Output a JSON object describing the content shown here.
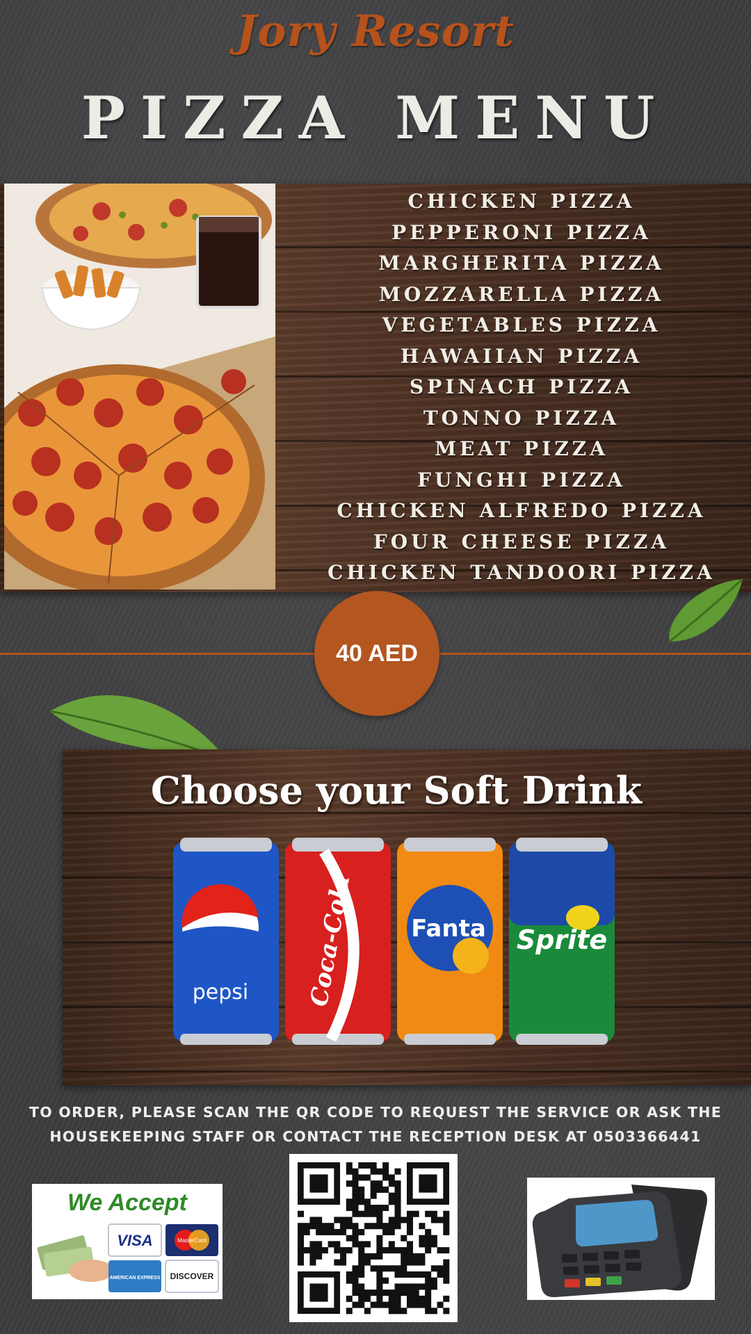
{
  "header": {
    "brand": "Jory Resort",
    "title": "PIZZA MENU"
  },
  "menu": {
    "items": [
      "CHICKEN PIZZA",
      "PEPPERONI PIZZA",
      "MARGHERITA PIZZA",
      "MOZZARELLA PIZZA",
      "VEGETABLES PIZZA",
      "HAWAIIAN PIZZA",
      "SPINACH PIZZA",
      "TONNO PIZZA",
      "MEAT PIZZA",
      "FUNGHI PIZZA",
      "CHICKEN ALFREDO PIZZA",
      "FOUR CHEESE PIZZA",
      "CHICKEN TANDOORI PIZZA"
    ],
    "price": "40 AED"
  },
  "drinks": {
    "title": "Choose your Soft Drink",
    "cans": [
      {
        "label": "pepsi",
        "color": "#1f56c6"
      },
      {
        "label": "Coca-Cola",
        "color": "#d8201f"
      },
      {
        "label": "Fanta",
        "color": "#f08a12"
      },
      {
        "label": "Sprite",
        "color": "#1a8a3a"
      }
    ]
  },
  "footer": {
    "order_note": "To order, please scan the QR code to request the service or ask the housekeeping staff or contact the reception desk at 0503366441",
    "payment": {
      "heading": "We Accept",
      "cards": [
        "VISA",
        "MasterCard",
        "AMERICAN EXPRESS",
        "DISCOVER"
      ]
    }
  },
  "colors": {
    "accent": "#b6521c",
    "background": "#3d3d3f",
    "text": "#f1eee6"
  },
  "icons": [
    "qr-code-icon",
    "card-terminal-icon",
    "leaf-icon",
    "cash-icon"
  ]
}
